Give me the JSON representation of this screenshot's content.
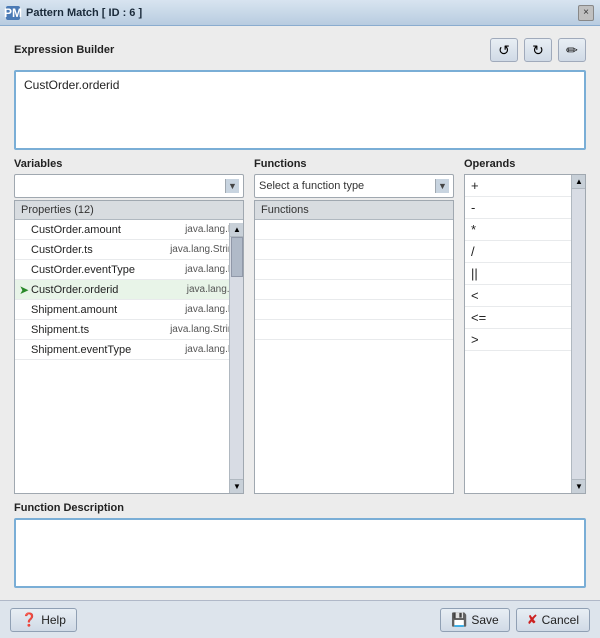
{
  "titleBar": {
    "icon": "PM",
    "title": "Pattern Match [ ID : 6 ]",
    "closeLabel": "×"
  },
  "toolbar": {
    "btn1": "↺",
    "btn2": "↻",
    "btn3": "✏"
  },
  "expressionBuilder": {
    "label": "Expression Builder",
    "value": "CustOrder.orderid"
  },
  "variables": {
    "label": "Variables",
    "dropdownPlaceholder": "",
    "listHeader": "Properties (12)",
    "rows": [
      {
        "name": "CustOrder.amount",
        "type": "java.lang.Lo",
        "selected": false,
        "active": false
      },
      {
        "name": "CustOrder.ts",
        "type": "java.lang.String",
        "selected": false,
        "active": false
      },
      {
        "name": "CustOrder.eventType",
        "type": "java.lang.Lo",
        "selected": false,
        "active": false
      },
      {
        "name": "CustOrder.orderid",
        "type": "java.lang.St",
        "selected": false,
        "active": true
      },
      {
        "name": "Shipment.amount",
        "type": "java.lang.Lo",
        "selected": false,
        "active": false
      },
      {
        "name": "Shipment.ts",
        "type": "java.lang.String",
        "selected": false,
        "active": false
      },
      {
        "name": "Shipment.eventType",
        "type": "java.lang.Lo",
        "selected": false,
        "active": false
      }
    ]
  },
  "functions": {
    "label": "Functions",
    "selectLabel": "Select a function type",
    "listHeader": "Functions",
    "rows": [
      "",
      "",
      "",
      "",
      "",
      ""
    ]
  },
  "operands": {
    "label": "Operands",
    "items": [
      "+",
      "-",
      "*",
      "/",
      "||",
      "<",
      "<=",
      ">"
    ]
  },
  "functionDescription": {
    "label": "Function Description"
  },
  "bottomBar": {
    "helpLabel": "Help",
    "saveLabel": "Save",
    "cancelLabel": "Cancel"
  }
}
